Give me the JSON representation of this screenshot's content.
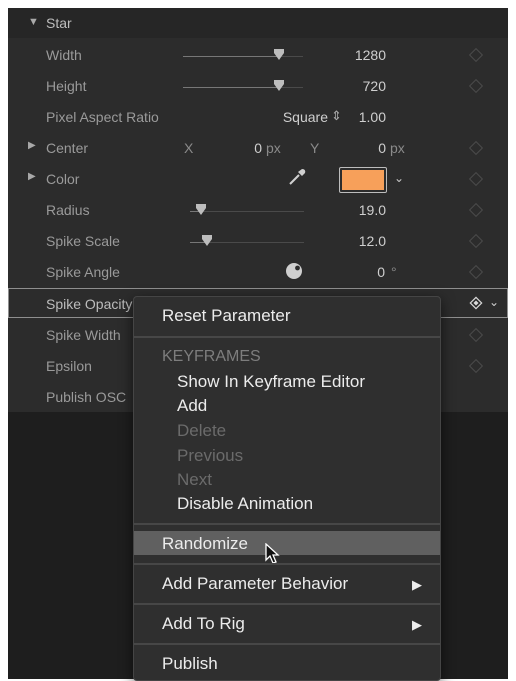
{
  "group": {
    "title": "Star"
  },
  "rows": {
    "width": {
      "label": "Width",
      "value": "1280",
      "slider": 0.8
    },
    "height": {
      "label": "Height",
      "value": "720",
      "slider": 0.8
    },
    "aspect": {
      "label": "Pixel Aspect Ratio",
      "mode": "Square",
      "value": "1.00"
    },
    "center": {
      "label": "Center",
      "x_label": "X",
      "x_value": "0",
      "x_unit": "px",
      "y_label": "Y",
      "y_value": "0",
      "y_unit": "px"
    },
    "color": {
      "label": "Color",
      "swatch": "#f7a05a"
    },
    "radius": {
      "label": "Radius",
      "value": "19.0",
      "slider": 0.1
    },
    "spike_scale": {
      "label": "Spike Scale",
      "value": "12.0",
      "slider": 0.15
    },
    "spike_angle": {
      "label": "Spike Angle",
      "value": "0",
      "unit": "°"
    },
    "spike_opacity": {
      "label": "Spike Opacity"
    },
    "spike_width": {
      "label": "Spike Width"
    },
    "epsilon": {
      "label": "Epsilon"
    },
    "publish_osc": {
      "label": "Publish OSC"
    }
  },
  "menu": {
    "reset": "Reset Parameter",
    "keyframes_header": "KEYFRAMES",
    "show_in_editor": "Show In Keyframe Editor",
    "add": "Add",
    "delete": "Delete",
    "previous": "Previous",
    "next": "Next",
    "disable_animation": "Disable Animation",
    "randomize": "Randomize",
    "add_behavior": "Add Parameter Behavior",
    "add_to_rig": "Add To Rig",
    "publish": "Publish"
  },
  "colors": {
    "panel_bg": "#2c2c2c",
    "menu_bg": "#2f2f2f",
    "highlight": "#606060",
    "swatch": "#f7a05a"
  }
}
